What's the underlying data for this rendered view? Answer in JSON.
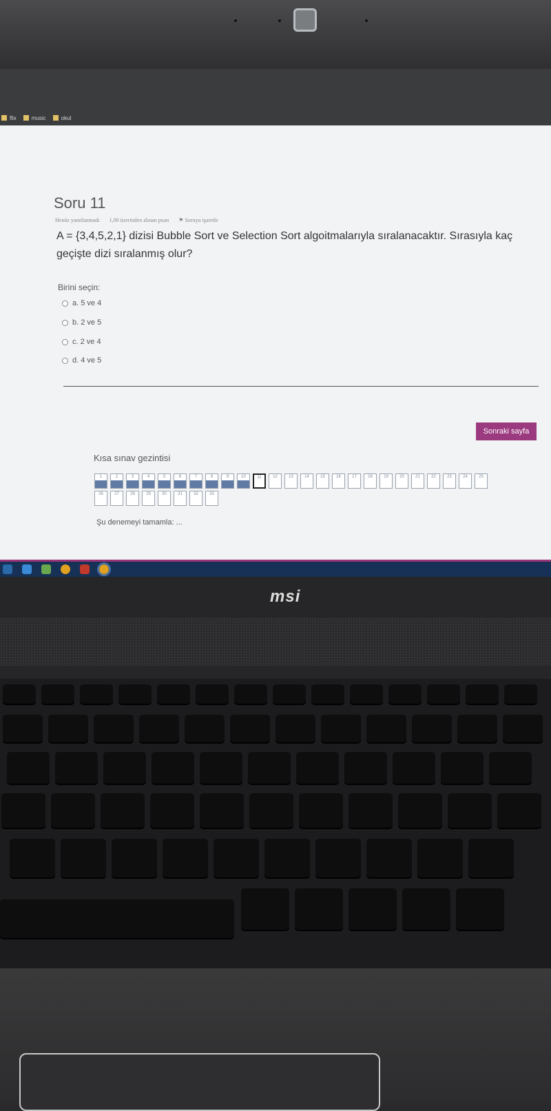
{
  "browser": {
    "bookmarks": [
      {
        "label": "flix"
      },
      {
        "label": "music"
      },
      {
        "label": "okul"
      }
    ]
  },
  "question": {
    "title": "Soru 11",
    "status": "Henüz yanıtlanmadı",
    "points": "1,00 üzerinden alınan puan",
    "flag_label": "Soruyu işaretle",
    "text": "A = {3,4,5,2,1} dizisi Bubble Sort ve Selection Sort algoitmalarıyla sıralanacaktır. Sırasıyla kaç geçişte dizi sıralanmış olur?",
    "choose_label": "Birini seçin:",
    "options": [
      "a. 5 ve 4",
      "b. 2 ve 5",
      "c. 2 ve 4",
      "d. 4 ve 5"
    ]
  },
  "next_button": "Sonraki sayfa",
  "navigation": {
    "title": "Kısa sınav gezintisi",
    "row1": [
      "1",
      "2",
      "3",
      "4",
      "5",
      "6",
      "7",
      "8",
      "9",
      "10",
      "11",
      "12",
      "13",
      "14",
      "15",
      "16",
      "17",
      "18",
      "19",
      "20",
      "21",
      "22",
      "23",
      "24",
      "25"
    ],
    "row2": [
      "26",
      "27",
      "28",
      "29",
      "30",
      "31",
      "32",
      "33"
    ],
    "answered_up_to": 10,
    "current": 11,
    "finish_link": "Şu denemeyi tamamla: ..."
  },
  "laptop": {
    "brand": "msi"
  },
  "colors": {
    "accent": "#9c3a80",
    "answered": "#5f7aa3",
    "taskbar": "#173056"
  }
}
